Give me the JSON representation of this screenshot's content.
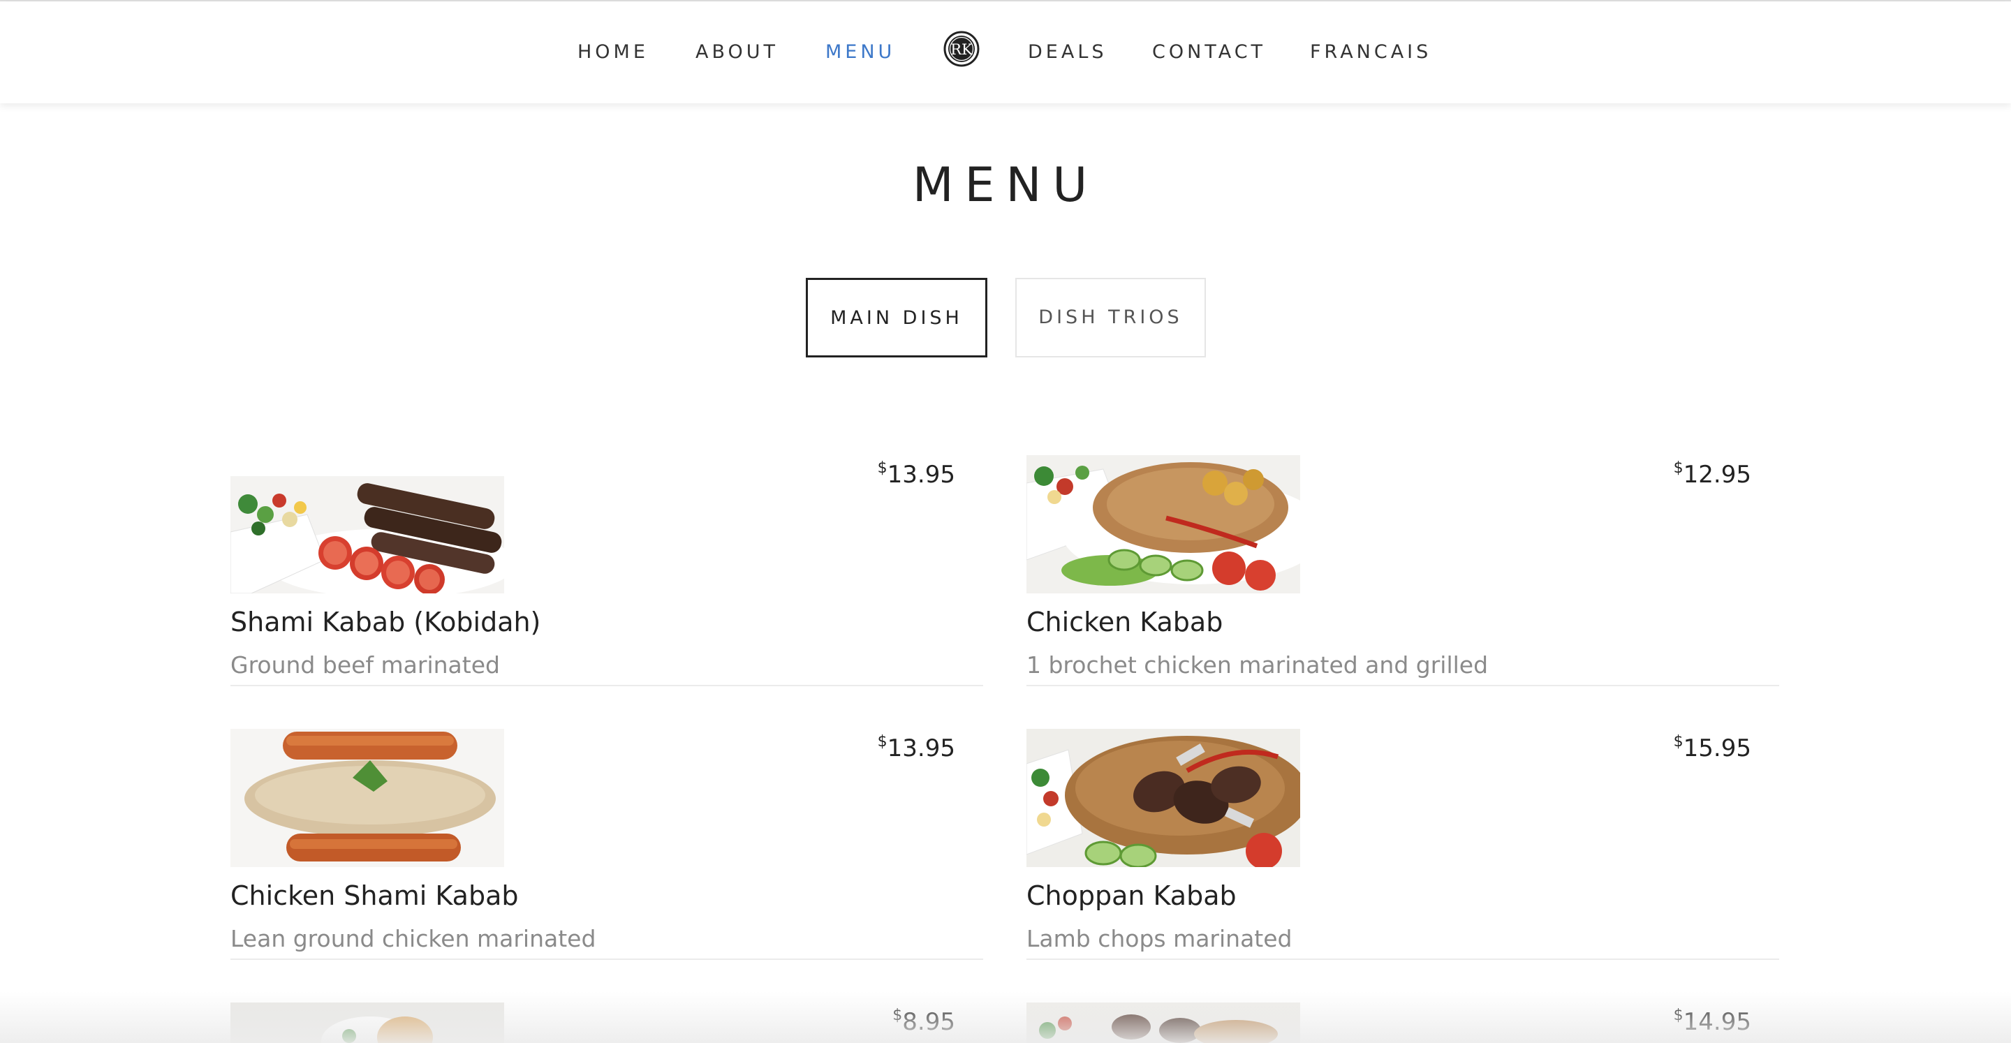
{
  "nav": {
    "items": [
      {
        "label": "HOME"
      },
      {
        "label": "ABOUT"
      },
      {
        "label": "MENU",
        "active": true
      },
      {
        "label": "DEALS"
      },
      {
        "label": "CONTACT"
      },
      {
        "label": "FRANCAIS"
      }
    ],
    "logo_icon": "rk-monogram-logo",
    "active_color": "#3d78c9"
  },
  "page": {
    "title": "MENU"
  },
  "tabs": [
    {
      "label": "MAIN DISH",
      "selected": true
    },
    {
      "label": "DISH TRIOS",
      "selected": false
    }
  ],
  "menu": {
    "currency": "$",
    "items": [
      {
        "name": "Shami Kabab (Kobidah)",
        "description": "Ground beef marinated",
        "price": "13.95",
        "photo": "beef-kabab-skewers-photo"
      },
      {
        "name": "Chicken Kabab",
        "description": "1 brochet chicken marinated and grilled",
        "price": "12.95",
        "photo": "chicken-kabab-rice-photo"
      },
      {
        "name": "Chicken Shami Kabab",
        "description": "Lean ground chicken marinated",
        "price": "13.95",
        "photo": "chicken-shami-kabab-photo"
      },
      {
        "name": "Choppan Kabab",
        "description": "Lamb chops marinated",
        "price": "15.95",
        "photo": "lamb-chops-rice-photo"
      },
      {
        "name": "",
        "description": "",
        "price": "8.95",
        "photo": "burger-photo"
      },
      {
        "name": "",
        "description": "",
        "price": "14.95",
        "photo": "meat-plate-photo"
      }
    ]
  }
}
